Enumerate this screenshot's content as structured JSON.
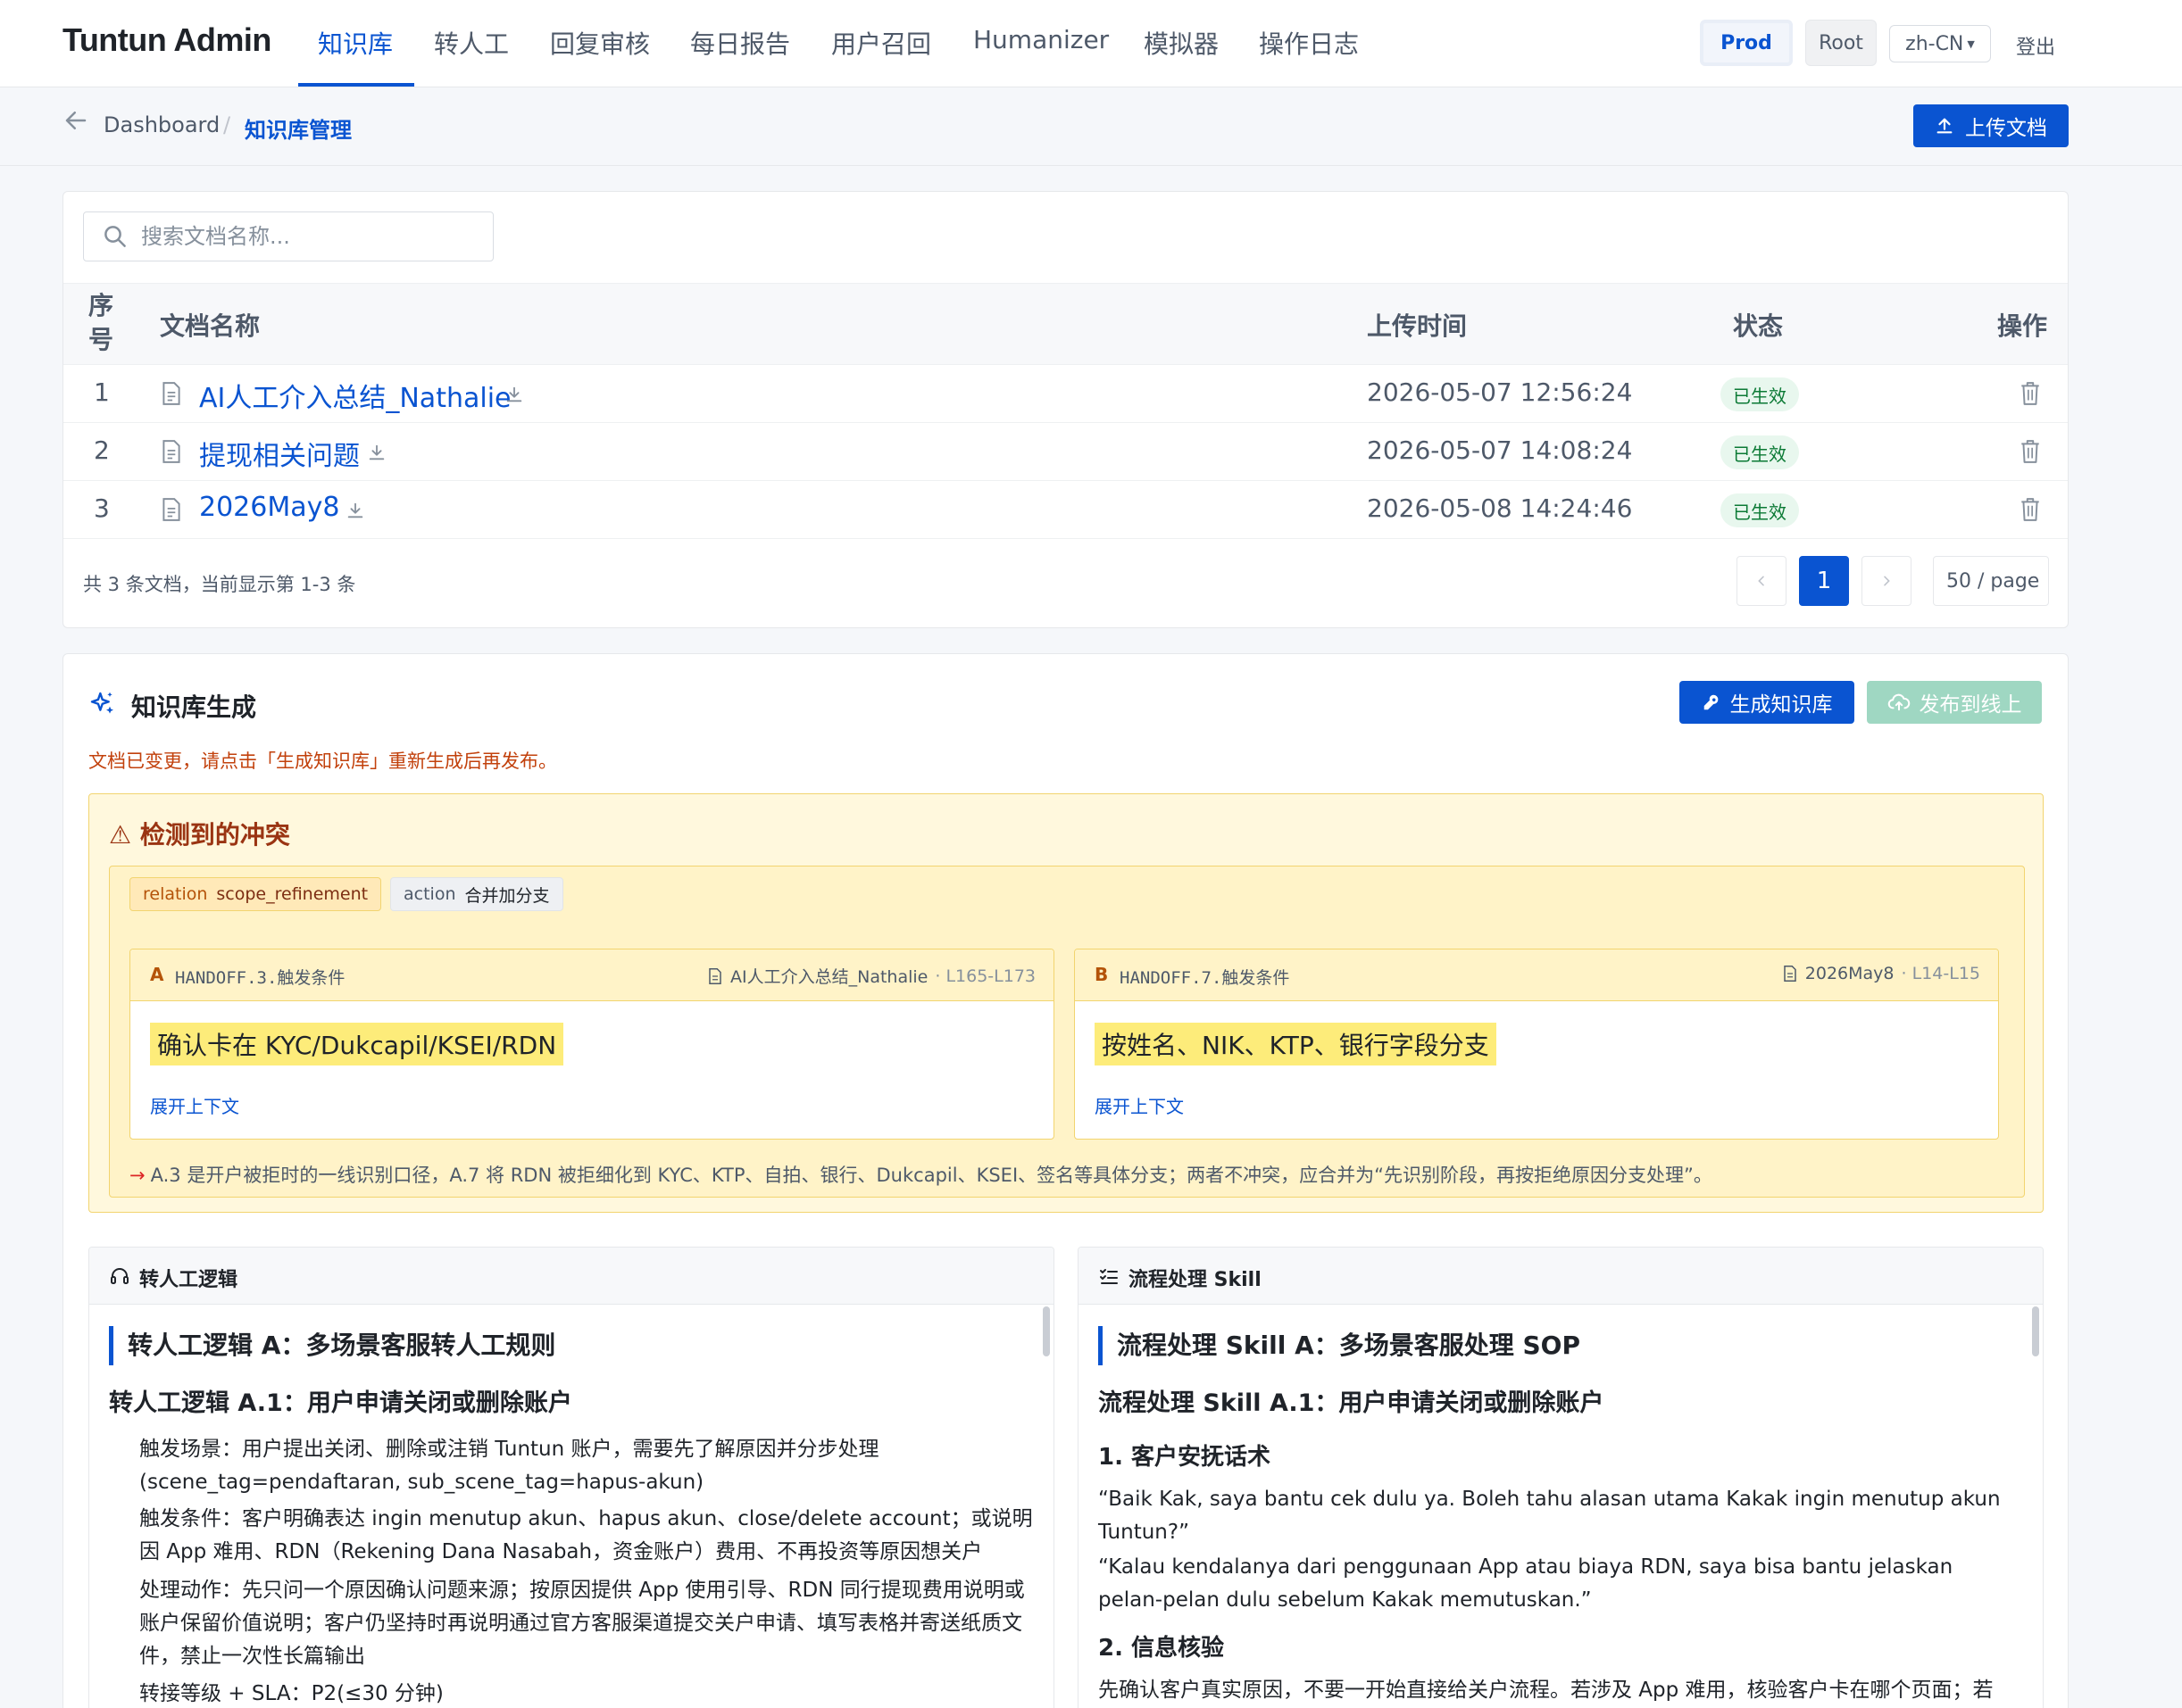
{
  "brand": "Tuntun Admin",
  "nav": {
    "tabs": [
      "知识库",
      "转人工",
      "回复审核",
      "每日报告",
      "用户召回",
      "Humanizer",
      "模拟器",
      "操作日志"
    ],
    "env": "Prod",
    "role": "Root",
    "lang": "zh-CN",
    "logout": "登出"
  },
  "breadcrumb": {
    "home": "Dashboard",
    "sep": "/",
    "current": "知识库管理"
  },
  "upload_label": "上传文档",
  "search": {
    "placeholder": "搜索文档名称...",
    "value": ""
  },
  "table": {
    "headers": {
      "seq": "序号",
      "name": "文档名称",
      "time": "上传时间",
      "status": "状态",
      "op": "操作"
    },
    "rows": [
      {
        "seq": "1",
        "name": "AI人工介入总结_Nathalie",
        "time": "2026-05-07 12:56:24",
        "status": "已生效"
      },
      {
        "seq": "2",
        "name": "提现相关问题",
        "time": "2026-05-07 14:08:24",
        "status": "已生效"
      },
      {
        "seq": "3",
        "name": "2026May8",
        "time": "2026-05-08 14:24:46",
        "status": "已生效"
      }
    ],
    "summary": "共 3 条文档，当前显示第 1-3 条",
    "page": "1",
    "page_size": "50 / page"
  },
  "kb_gen": {
    "title": "知识库生成",
    "generate_label": "生成知识库",
    "publish_label": "发布到线上",
    "warning": "文档已变更，请点击「生成知识库」重新生成后再发布。",
    "conflict": {
      "title": "⚠ 检测到的冲突",
      "relation_key": "relation",
      "relation_val": "scope_refinement",
      "action_key": "action",
      "action_val": "合并加分支",
      "a": {
        "letter": "A",
        "code": "HANDOFF.3.触发条件",
        "source": "AI人工介入总结_Nathalie",
        "lines": "· L165-L173",
        "highlight": "确认卡在 KYC/Dukcapil/KSEI/RDN",
        "expand": "展开上下文"
      },
      "b": {
        "letter": "B",
        "code": "HANDOFF.7.触发条件",
        "source": "2026May8",
        "lines": "· L14-L15",
        "highlight": "按姓名、NIK、KTP、银行字段分支",
        "expand": "展开上下文"
      },
      "arrow": "→",
      "note": "A.3 是开户被拒时的一线识别口径，A.7 将 RDN 被拒细化到 KYC、KTP、自拍、银行、Dukcapil、KSEI、签名等具体分支；两者不冲突，应合并为“先识别阶段，再按拒绝原因分支处理”。"
    },
    "left_panel": {
      "title": "转人工逻辑",
      "h1": "转人工逻辑 A：多场景客服转人工规则",
      "h2": "转人工逻辑 A.1：用户申请关闭或删除账户",
      "p1": "触发场景：用户提出关闭、删除或注销 Tuntun 账户，需要先了解原因并分步处理 (scene_tag=pendaftaran, sub_scene_tag=hapus-akun)",
      "p2": "触发条件：客户明确表达 ingin menutup akun、hapus akun、close/delete account；或说明因 App 难用、RDN（Rekening Dana Nasabah，资金账户）费用、不再投资等原因想关户",
      "p3": "处理动作：先只问一个原因确认问题来源；按原因提供 App 使用引导、RDN 同行提现费用说明或账户保留价值说明；客户仍坚持时再说明通过官方客服渠道提交关户申请、填写表格并寄送纸质文件，禁止一次性长篇输出",
      "p4": "转接等级 + SLA：P2(≤30 分钟)"
    },
    "right_panel": {
      "title": "流程处理 Skill",
      "h1": "流程处理 Skill A：多场景客服处理 SOP",
      "h2": "流程处理 Skill A.1：用户申请关闭或删除账户",
      "h3a": "1. 客户安抚话术",
      "p1": "“Baik Kak, saya bantu cek dulu ya. Boleh tahu alasan utama Kakak ingin menutup akun Tuntun?”",
      "p2": "“Kalau kendalanya dari penggunaan App atau biaya RDN, saya bisa bantu jelaskan pelan-pelan dulu sebelum Kakak memutuskan.”",
      "h3b": "2. 信息核验",
      "p3": "先确认客户真实原因，不要一开始直接给关户流程。若涉及 App 难用，核验客户卡在哪个页面；若"
    }
  }
}
